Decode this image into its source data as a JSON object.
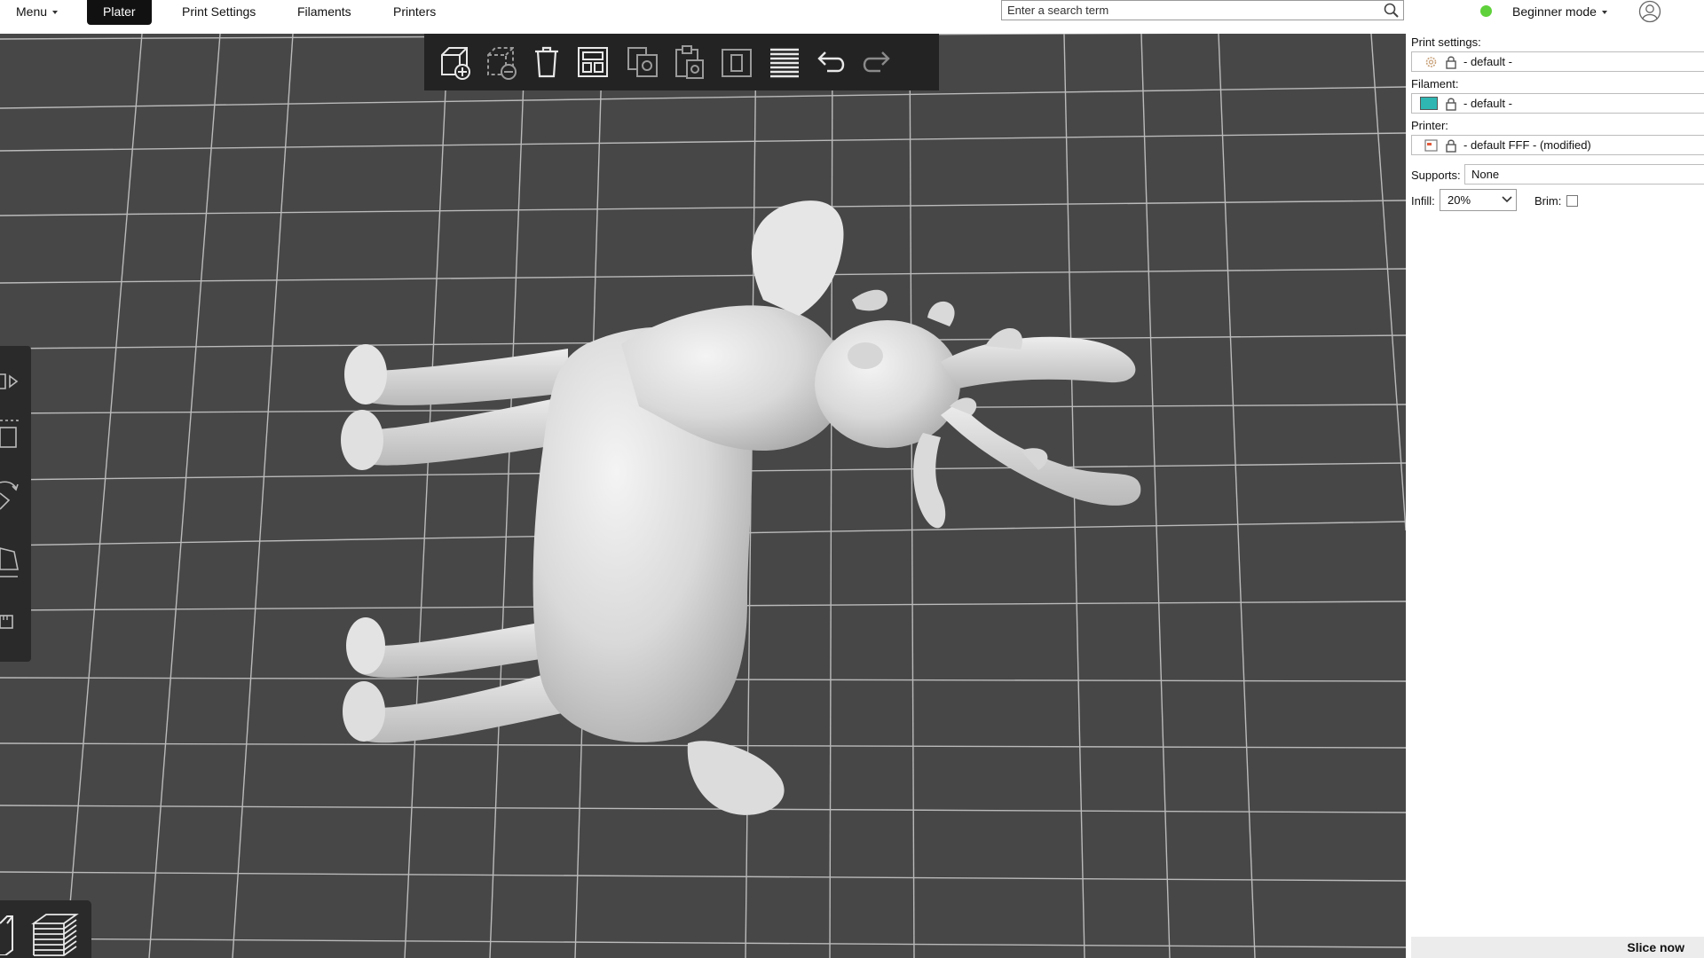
{
  "topbar": {
    "menu_label": "Menu",
    "tabs": [
      {
        "label": "Plater",
        "active": true
      },
      {
        "label": "Print Settings",
        "active": false
      },
      {
        "label": "Filaments",
        "active": false
      },
      {
        "label": "Printers",
        "active": false
      }
    ],
    "search": {
      "placeholder": "Enter a search term",
      "value": ""
    },
    "status_color": "#5fd13a",
    "mode_label": "Beginner mode",
    "user_icon": "user-icon"
  },
  "toolbar": {
    "buttons": [
      "add-object-icon",
      "delete-object-icon",
      "delete-all-icon",
      "arrange-icon",
      "copy-icon",
      "paste-icon",
      "add-instance-icon",
      "split-layers-icon",
      "undo-icon",
      "redo-icon"
    ]
  },
  "left_toolbar": {
    "buttons": [
      "move-icon",
      "scale-icon",
      "rotate-icon",
      "place-on-face-icon",
      "cut-icon"
    ]
  },
  "view_toggle": {
    "buttons": [
      "3d-view-icon",
      "preview-layers-icon"
    ]
  },
  "viewport": {
    "background": "#474747",
    "grid_color": "#c8c8c8",
    "model": "deer-model"
  },
  "panel": {
    "print_settings_label": "Print settings:",
    "print_settings_value": "- default -",
    "filament_label": "Filament:",
    "filament_value": "- default -",
    "filament_color": "#2fb6b2",
    "printer_label": "Printer:",
    "printer_value": "- default FFF - (modified)",
    "supports_label": "Supports:",
    "supports_value": "None",
    "infill_label": "Infill:",
    "infill_value": "20%",
    "brim_label": "Brim:",
    "brim_checked": false,
    "slice_button": "Slice now"
  }
}
